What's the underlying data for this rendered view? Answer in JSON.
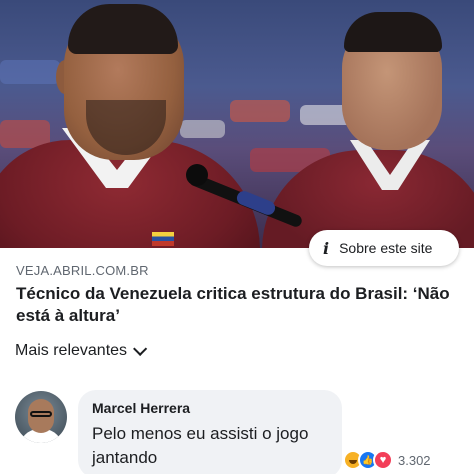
{
  "about_site": {
    "label": "Sobre este site",
    "icon": "info-icon"
  },
  "link_preview": {
    "image_alt": "press conference photo",
    "source": "VEJA.ABRIL.COM.BR",
    "headline": "Técnico da Venezuela critica estrutura do Brasil: ‘Não está à altura’"
  },
  "sort": {
    "label": "Mais relevantes",
    "icon": "chevron-down-icon"
  },
  "comment": {
    "author": "Marcel Herrera",
    "text": "Pelo menos eu assisti o jogo jantando",
    "reactions": [
      "haha",
      "like",
      "love"
    ],
    "reaction_count": "3.302"
  },
  "colors": {
    "like": "#1877f2",
    "love": "#f33e58",
    "haha": "#f7b125",
    "bubble_bg": "#f0f2f5",
    "secondary_text": "#606770"
  }
}
